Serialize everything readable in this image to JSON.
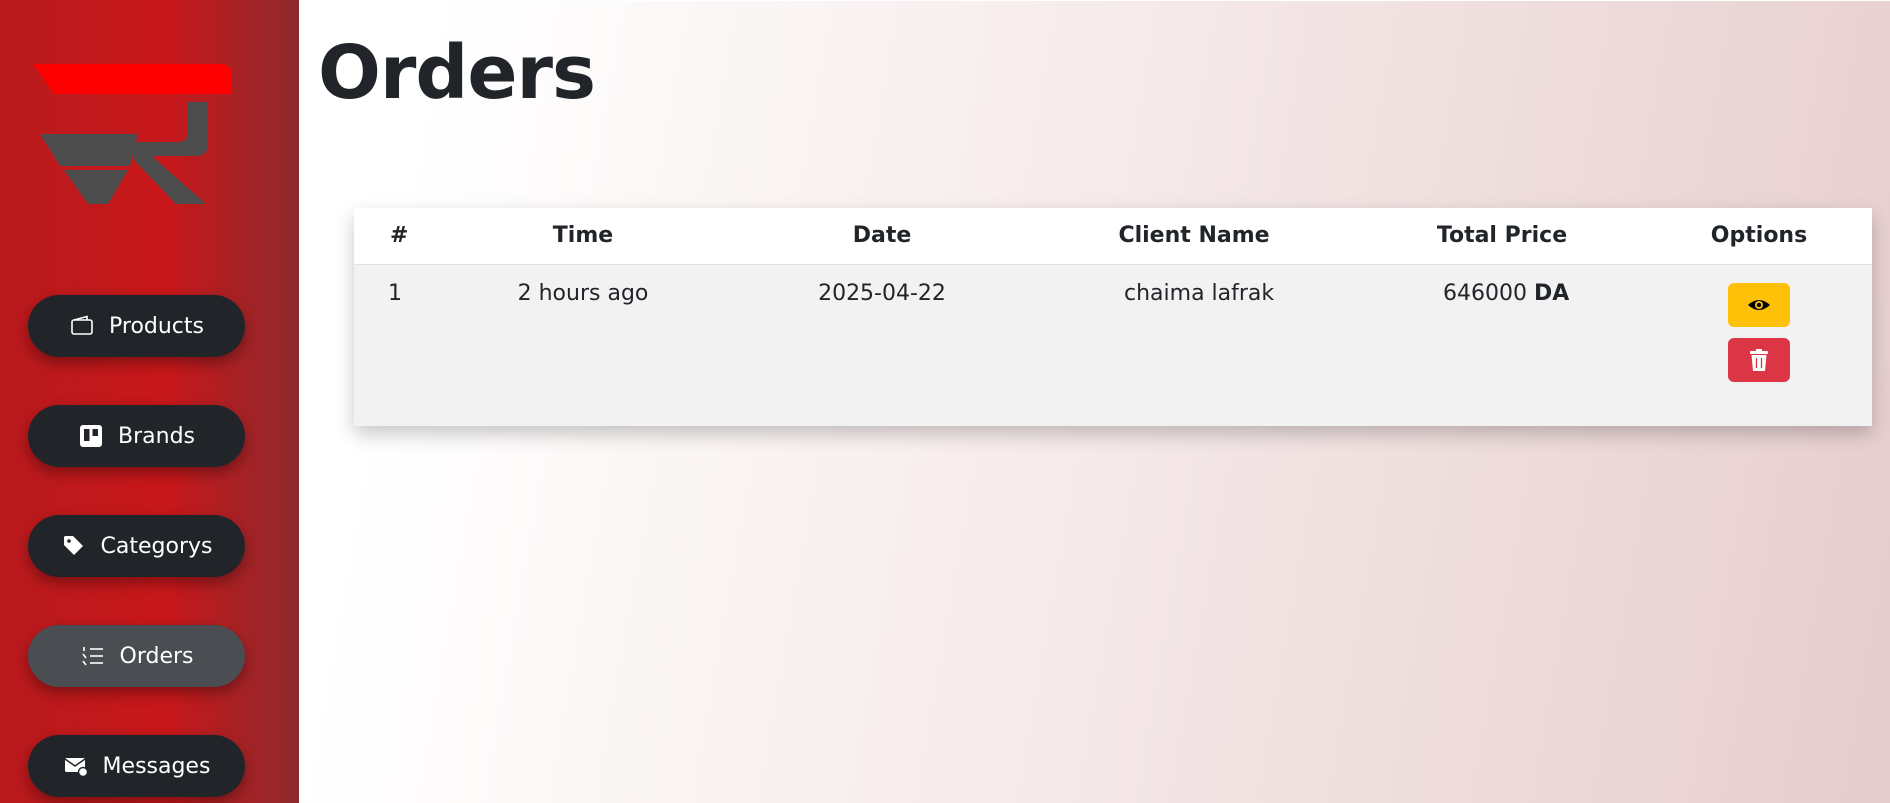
{
  "sidebar": {
    "logo": "logo-icon",
    "items": [
      {
        "label": "Products",
        "icon": "wallet-icon",
        "active": false
      },
      {
        "label": "Brands",
        "icon": "trello-icon",
        "active": false
      },
      {
        "label": "Categorys",
        "icon": "tags-icon",
        "active": false
      },
      {
        "label": "Orders",
        "icon": "list-ol-icon",
        "active": true
      },
      {
        "label": "Messages",
        "icon": "envelope-icon",
        "active": false
      }
    ]
  },
  "main": {
    "title": "Orders",
    "table": {
      "headers": [
        "#",
        "Time",
        "Date",
        "Client Name",
        "Total Price",
        "Options"
      ],
      "rows": [
        {
          "index": "1",
          "time": "2 hours ago",
          "date": "2025-04-22",
          "client": "chaima lafrak",
          "price": "646000",
          "currency": "DA"
        }
      ],
      "options": {
        "view_icon": "eye-icon",
        "delete_icon": "trash-icon"
      }
    }
  },
  "colors": {
    "sidebar": "#c8171a",
    "nav_button": "#212529",
    "nav_button_active": "#4a4d51",
    "view_button": "#ffc107",
    "delete_button": "#dc3545",
    "logo_red": "#ff0000",
    "logo_gray": "#4d4d4d"
  }
}
